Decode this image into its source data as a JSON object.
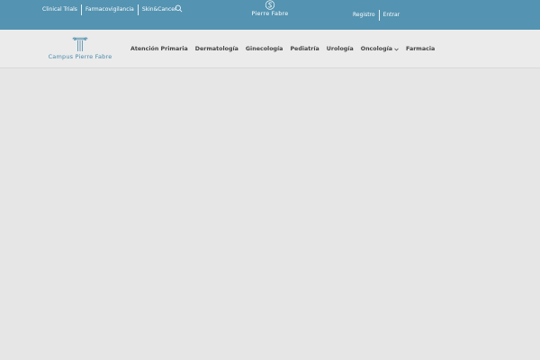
{
  "topbar": {
    "links": [
      "Clinical Trials",
      "Farmacovigilancia",
      "Skin&Cancer"
    ],
    "brand_name": "Pierre Fabre",
    "account": {
      "register": "Registro",
      "login": "Entrar"
    }
  },
  "header": {
    "logo_text": "Campus Pierre Fabre",
    "menu": [
      {
        "label": "Atención Primaria"
      },
      {
        "label": "Dermatología"
      },
      {
        "label": "Ginecología"
      },
      {
        "label": "Pediatría"
      },
      {
        "label": "Urología"
      },
      {
        "label": "Oncología",
        "has_dropdown": true
      },
      {
        "label": "Farmacia"
      }
    ]
  },
  "colors": {
    "topbar_bg": "#5493b1",
    "logo_text": "#4a8bab",
    "page_bg": "#e6e6e6"
  },
  "icons": [
    "search-icon",
    "pierre-fabre-mark-icon",
    "campus-column-icon",
    "chevron-down-icon"
  ]
}
